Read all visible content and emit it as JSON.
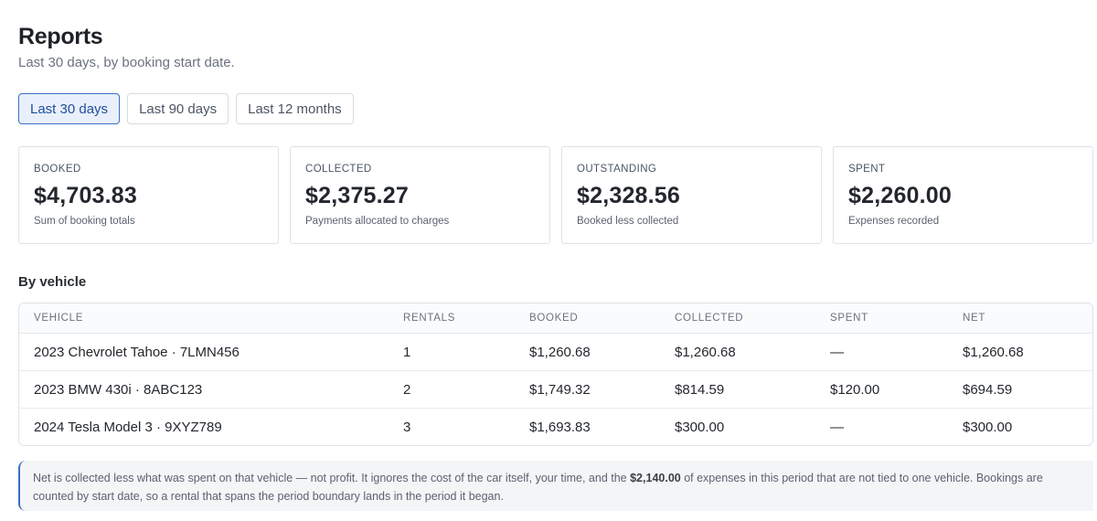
{
  "header": {
    "title": "Reports",
    "subtitle": "Last 30 days, by booking start date."
  },
  "range_tabs": [
    {
      "label": "Last 30 days",
      "active": true
    },
    {
      "label": "Last 90 days",
      "active": false
    },
    {
      "label": "Last 12 months",
      "active": false
    }
  ],
  "stats": [
    {
      "label": "BOOKED",
      "value": "$4,703.83",
      "note": "Sum of booking totals"
    },
    {
      "label": "COLLECTED",
      "value": "$2,375.27",
      "note": "Payments allocated to charges"
    },
    {
      "label": "OUTSTANDING",
      "value": "$2,328.56",
      "note": "Booked less collected"
    },
    {
      "label": "SPENT",
      "value": "$2,260.00",
      "note": "Expenses recorded"
    }
  ],
  "by_vehicle": {
    "title": "By vehicle",
    "columns": [
      "VEHICLE",
      "RENTALS",
      "BOOKED",
      "COLLECTED",
      "SPENT",
      "NET"
    ],
    "rows": [
      {
        "vehicle": "2023 Chevrolet Tahoe · 7LMN456",
        "rentals": "1",
        "booked": "$1,260.68",
        "collected": "$1,260.68",
        "spent": "—",
        "net": "$1,260.68"
      },
      {
        "vehicle": "2023 BMW 430i · 8ABC123",
        "rentals": "2",
        "booked": "$1,749.32",
        "collected": "$814.59",
        "spent": "$120.00",
        "net": "$694.59"
      },
      {
        "vehicle": "2024 Tesla Model 3 · 9XYZ789",
        "rentals": "3",
        "booked": "$1,693.83",
        "collected": "$300.00",
        "spent": "—",
        "net": "$300.00"
      }
    ]
  },
  "note": {
    "text_before": "Net is collected less what was spent on that vehicle — not profit. It ignores the cost of the car itself, your time, and the ",
    "amount": "$2,140.00",
    "text_after": " of expenses in this period that are not tied to one vehicle. Bookings are counted by start date, so a rental that spans the period boundary lands in the period it began."
  },
  "colors": {
    "accent": "#3b6fc4",
    "active_tab_bg": "#e9f0fb"
  }
}
